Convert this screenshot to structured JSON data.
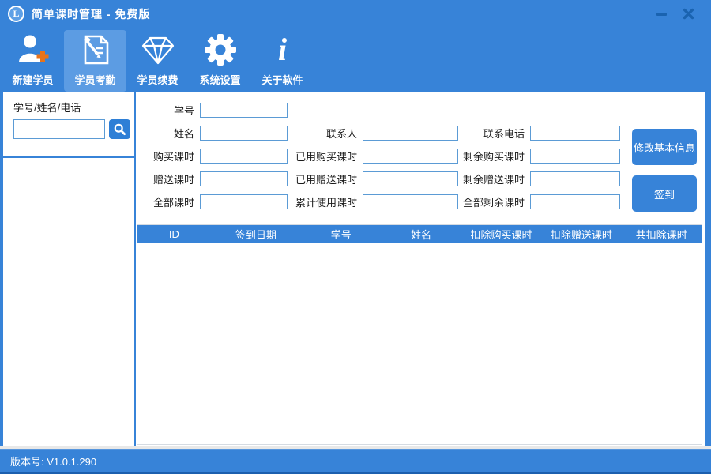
{
  "window": {
    "title": "简单课时管理 - 免费版",
    "logo_letter": "L"
  },
  "toolbar": {
    "items": [
      {
        "label": "新建学员",
        "icon": "person-add-icon",
        "active": false
      },
      {
        "label": "学员考勤",
        "icon": "document-pencil-icon",
        "active": true
      },
      {
        "label": "学员续费",
        "icon": "diamond-icon",
        "active": false
      },
      {
        "label": "系统设置",
        "icon": "gear-icon",
        "active": false
      },
      {
        "label": "关于软件",
        "icon": "info-icon",
        "active": false
      }
    ]
  },
  "sidebar": {
    "search_label": "学号/姓名/电话",
    "search_value": "",
    "list_items": []
  },
  "form": {
    "fields": [
      {
        "label": "学号",
        "value": ""
      },
      {
        "label": "姓名",
        "value": ""
      },
      {
        "label": "联系人",
        "value": ""
      },
      {
        "label": "联系电话",
        "value": ""
      },
      {
        "label": "购买课时",
        "value": ""
      },
      {
        "label": "已用购买课时",
        "value": ""
      },
      {
        "label": "剩余购买课时",
        "value": ""
      },
      {
        "label": "赠送课时",
        "value": ""
      },
      {
        "label": "已用赠送课时",
        "value": ""
      },
      {
        "label": "剩余赠送课时",
        "value": ""
      },
      {
        "label": "全部课时",
        "value": ""
      },
      {
        "label": "累计使用课时",
        "value": ""
      },
      {
        "label": "全部剩余课时",
        "value": ""
      }
    ]
  },
  "actions": {
    "edit_info_label": "修改基本信息",
    "checkin_label": "签到"
  },
  "table": {
    "columns": [
      "ID",
      "签到日期",
      "学号",
      "姓名",
      "扣除购买课时",
      "扣除赠送课时",
      "共扣除课时"
    ],
    "rows": []
  },
  "statusbar": {
    "version_text": "版本号: V1.0.1.290"
  },
  "icons": {
    "info_glyph": "i"
  },
  "colors": {
    "primary_blue": "#3783d8",
    "active_item_blue": "#5c9ce3",
    "control_glyph_blue": "#1a63b0",
    "input_border_blue": "#5b9bd5",
    "search_button_blue": "#2e7fd6",
    "plus_orange": "#e8731a",
    "status_dark_edge": "#1c5fae"
  }
}
